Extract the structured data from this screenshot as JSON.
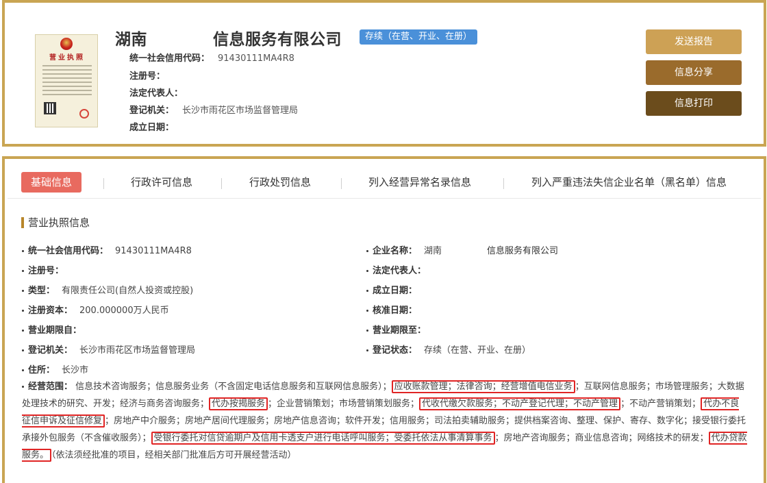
{
  "header": {
    "license_image": {
      "title": "营业执照"
    },
    "company_name_prefix": "湖南",
    "company_name_suffix": "信息服务有限公司",
    "status_badge": "存续（在营、开业、在册）",
    "rows": [
      {
        "key": "统一社会信用代码：",
        "value": "91430111MA4R8"
      },
      {
        "key": "注册号：",
        "value": ""
      },
      {
        "key": "法定代表人：",
        "value": ""
      },
      {
        "key": "登记机关：",
        "value": "长沙市雨花区市场监督管理局"
      },
      {
        "key": "成立日期：",
        "value": ""
      }
    ],
    "buttons": {
      "report": "发送报告",
      "share": "信息分享",
      "print": "信息打印"
    }
  },
  "tabs": [
    {
      "label": "基础信息",
      "active": true
    },
    {
      "label": "行政许可信息"
    },
    {
      "label": "行政处罚信息"
    },
    {
      "label": "列入经营异常名录信息"
    },
    {
      "label": "列入严重违法失信企业名单（黑名单）信息"
    }
  ],
  "section_title": "营业执照信息",
  "fields_left": [
    {
      "key": "统一社会信用代码：",
      "value": "91430111MA4R8"
    },
    {
      "key": "注册号：",
      "value": ""
    },
    {
      "key": "类型：",
      "value": "有限责任公司(自然人投资或控股)"
    },
    {
      "key": "注册资本：",
      "value": "200.000000万人民币"
    },
    {
      "key": "营业期限自：",
      "value": ""
    },
    {
      "key": "登记机关：",
      "value": "长沙市雨花区市场监督管理局"
    },
    {
      "key": "住所：",
      "value": "长沙市"
    }
  ],
  "fields_right": [
    {
      "key": "企业名称：",
      "value_prefix": "湖南",
      "value_suffix": "信息服务有限公司"
    },
    {
      "key": "法定代表人：",
      "value": ""
    },
    {
      "key": "成立日期：",
      "value": ""
    },
    {
      "key": "核准日期：",
      "value": ""
    },
    {
      "key": "营业期限至：",
      "value": ""
    },
    {
      "key": "登记状态：",
      "value": "存续（在营、开业、在册）"
    }
  ],
  "scope": {
    "key": "经营范围：",
    "segments": [
      {
        "text": "信息技术咨询服务；信息服务业务（不含固定电话信息服务和互联网信息服务）；"
      },
      {
        "text": "应收账款管理；法律咨询；经营增值电信业务",
        "highlight": true
      },
      {
        "text": "；互联网信息服务；市场管理服务；大数据处理技术的研究、开发；经济与商务咨询服务；"
      },
      {
        "text": "代办按揭服务",
        "highlight": true
      },
      {
        "text": "；企业营销策划；市场营销策划服务；"
      },
      {
        "text": "代收代缴欠款服务；不动产登记代理；不动产管理",
        "highlight": true
      },
      {
        "text": "；不动产营销策划；"
      },
      {
        "text": "代办不良征信申诉及征信修复",
        "highlight": true
      },
      {
        "text": "；房地产中介服务；房地产居间代理服务；房地产信息咨询；软件开发；信用服务；司法拍卖辅助服务；提供档案咨询、整理、保护、寄存、数字化；接受银行委托承接外包服务（不含催收服务）；"
      },
      {
        "text": "受银行委托对信贷逾期户及信用卡透支户进行电话呼叫服务；受委托依法从事清算事务",
        "highlight": true
      },
      {
        "text": "；房地产咨询服务；商业信息咨询；网络技术的研发；"
      },
      {
        "text": "代办贷款服务。",
        "highlight": true
      },
      {
        "text": "（依法须经批准的项目，经相关部门批准后方可开展经营活动）"
      }
    ]
  }
}
